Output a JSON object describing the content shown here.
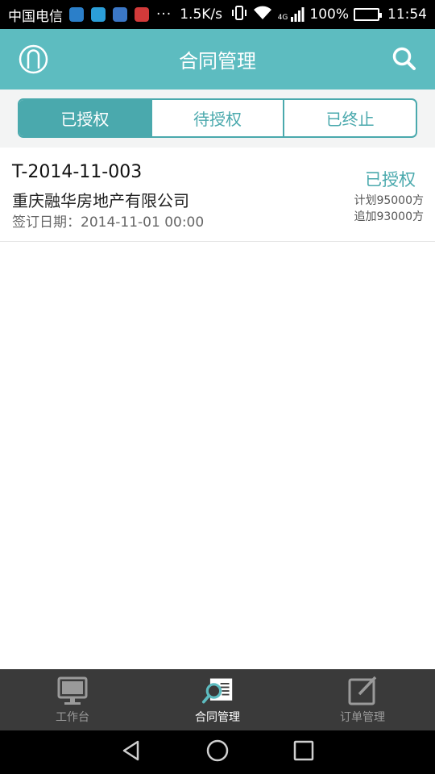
{
  "status_bar": {
    "carrier": "中国电信",
    "more": "···",
    "speed": "1.5K/s",
    "network": "4G",
    "battery": "100%",
    "time": "11:54"
  },
  "app_bar": {
    "title": "合同管理",
    "left_icon": "user-icon",
    "right_icon": "search-icon"
  },
  "tabs": [
    {
      "label": "已授权",
      "active": true
    },
    {
      "label": "待授权",
      "active": false
    },
    {
      "label": "已终止",
      "active": false
    }
  ],
  "contracts": [
    {
      "code": "T-2014-11-003",
      "company": "重庆融华房地产有限公司",
      "date": "签订日期：2014-11-01 00:00",
      "status": "已授权",
      "plan": "计划95000方",
      "extra": "追加93000方"
    }
  ],
  "bottom_nav": [
    {
      "label": "工作台",
      "icon": "monitor-icon",
      "active": false
    },
    {
      "label": "合同管理",
      "icon": "contract-search-icon",
      "active": true
    },
    {
      "label": "订单管理",
      "icon": "edit-icon",
      "active": false
    }
  ],
  "colors": {
    "accent": "#4aa9ad",
    "appbar": "#5dbcc0",
    "nav_background": "#3a3a3a"
  }
}
